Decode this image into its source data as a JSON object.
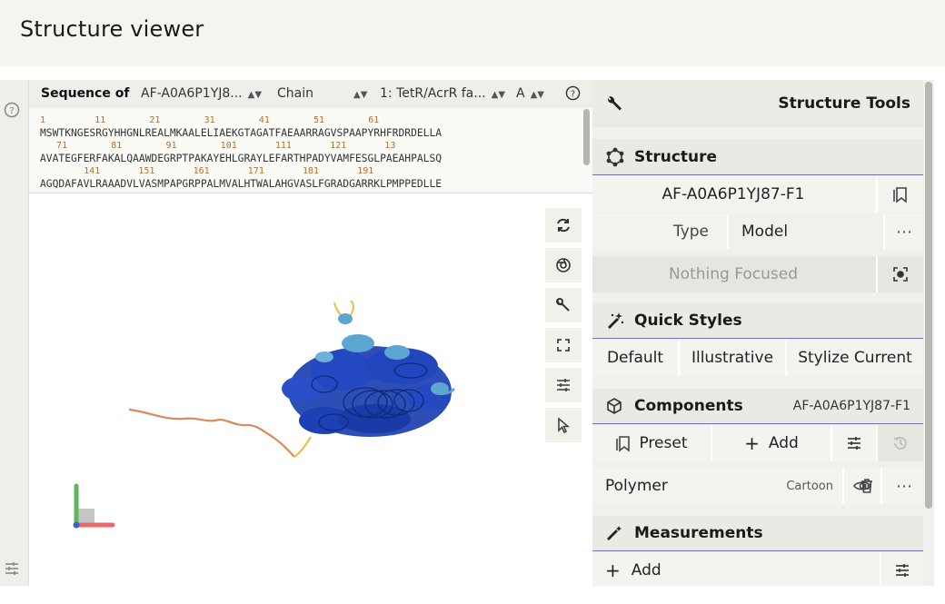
{
  "header": {
    "title": "Structure viewer"
  },
  "sequence": {
    "label": "Sequence of",
    "entry": "AF-A0A6P1YJ8...",
    "mode": "Chain",
    "chain": "1: TetR/AcrR fa...",
    "asym": "A",
    "lines": [
      {
        "nums": [
          "1",
          "11",
          "21",
          "31",
          "41",
          "51",
          "61"
        ],
        "seq": "MSWTKNGESRGYHHGNLREALMKAALELIAEKGTAGATFAEAARRAGVSPAAPYRHFRDRDELLA"
      },
      {
        "nums": [
          "71",
          "81",
          "91",
          "101",
          "111",
          "121",
          "13"
        ],
        "seq": "AVATEGFERFAKALQAAWDEGRPTPAKAYEHLGRAYLEFARTHPADYVAMFESGLPAEAHPALSQ"
      },
      {
        "nums": [
          "141",
          "151",
          "161",
          "171",
          "181",
          "191"
        ],
        "seq": "AGQDAFAVLRAAADVLVASMPAPGRPPALMVALHTWALAHGVASLFGRADGARRKLPMPPEDLLE"
      }
    ]
  },
  "viewer_tools": [
    "reset-camera-icon",
    "screenshot-icon",
    "wrench-icon",
    "fullscreen-icon",
    "settings-sliders-icon",
    "select-pointer-icon"
  ],
  "right": {
    "tools_title": "Structure Tools",
    "structure_title": "Structure",
    "structure_name": "AF-A0A6P1YJ87-F1",
    "type_label": "Type",
    "type_value": "Model",
    "focus_text": "Nothing Focused",
    "quick_styles_title": "Quick Styles",
    "quick_styles": [
      "Default",
      "Illustrative",
      "Stylize Current"
    ],
    "components_title": "Components",
    "components_entry": "AF-A0A6P1YJ87-F1",
    "preset_label": "Preset",
    "add_label": "Add",
    "polymer_label": "Polymer",
    "polymer_repr": "Cartoon",
    "measurements_title": "Measurements",
    "measure_add_label": "Add"
  },
  "colors": {
    "accent_line": "#7d6ab3",
    "helix_dark": "#1a3fb0",
    "helix_light": "#5ea6d2",
    "coil_orange": "#d98a5a",
    "coil_yellow": "#e6c04a"
  }
}
